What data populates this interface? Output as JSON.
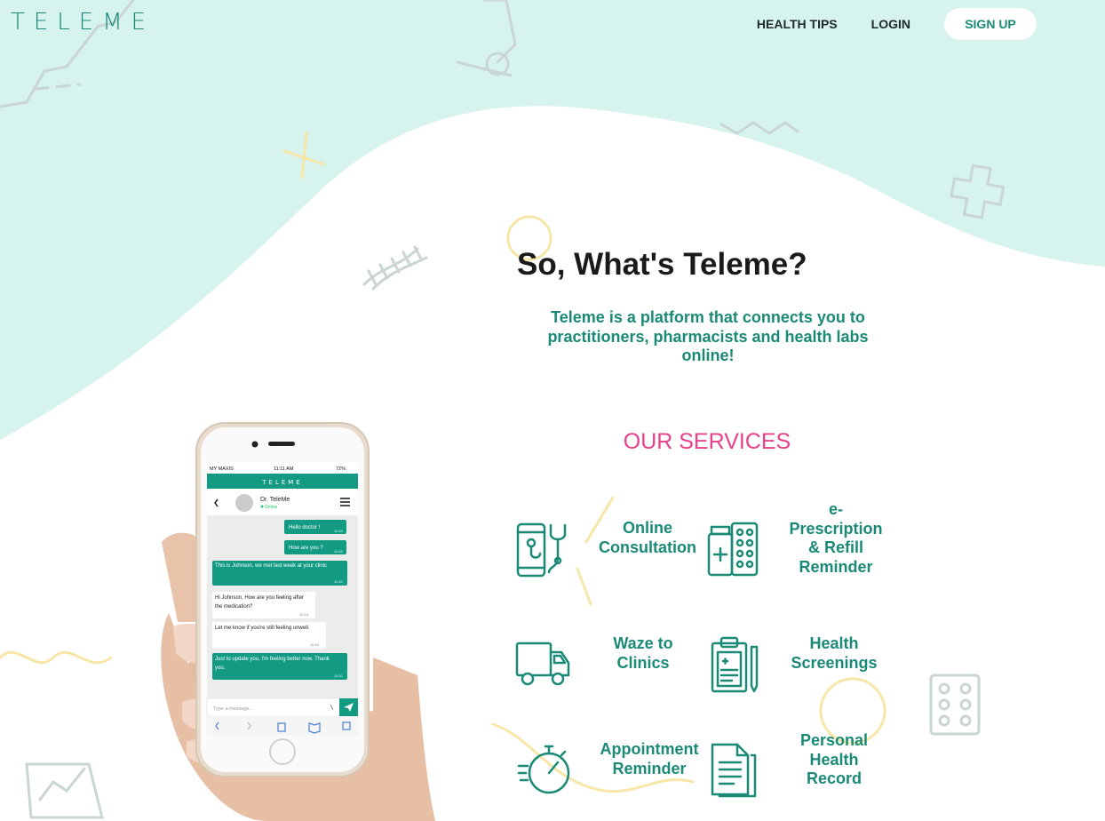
{
  "brand": {
    "logo_text": "TELEME",
    "accent": "#1a8a77",
    "mint": "#d6f3ee",
    "pink": "#e8418b"
  },
  "nav": {
    "health_tips": "HEALTH TIPS",
    "login": "LOGIN",
    "signup": "SIGN UP"
  },
  "hero": {
    "title": "So, What's Teleme?",
    "tagline": "Teleme is a platform that connects you to practitioners, pharmacists and health labs online!"
  },
  "services": {
    "title": "OUR SERVICES",
    "items": [
      {
        "label": "Online Consultation",
        "icon": "phone-stethoscope-icon"
      },
      {
        "label": "e-Prescription & Refill Reminder",
        "icon": "pill-bottle-icon"
      },
      {
        "label": "Waze to Clinics",
        "icon": "truck-icon"
      },
      {
        "label": "Health Screenings",
        "icon": "clipboard-icon"
      },
      {
        "label": "Appointment Reminder",
        "icon": "stopwatch-icon"
      },
      {
        "label": "Personal Health Record",
        "icon": "document-icon"
      }
    ]
  },
  "phone": {
    "status": {
      "carrier": "MY MAXIS",
      "time": "11:11 AM",
      "battery": "72%"
    },
    "app_title": "TELEME",
    "contact": {
      "name": "Dr. TeleMe",
      "status": "Online"
    },
    "messages": [
      {
        "from": "me",
        "text": "Hello doctor !",
        "time": "11:09"
      },
      {
        "from": "me",
        "text": "How are you ?",
        "time": "11:09"
      },
      {
        "from": "me",
        "text": "This is Johnson, we met last week at your clinic",
        "time": "11:10"
      },
      {
        "from": "doc",
        "text": "Hi Johnson, How are you feeling after the medication?",
        "time": "11:13"
      },
      {
        "from": "doc",
        "text": "Let me know if you're still feeling unwell.",
        "time": "11:14"
      },
      {
        "from": "me",
        "text": "Just to update you, I'm feeling better now. Thank you.",
        "time": "11:20"
      }
    ],
    "input_placeholder": "Type a message..."
  }
}
